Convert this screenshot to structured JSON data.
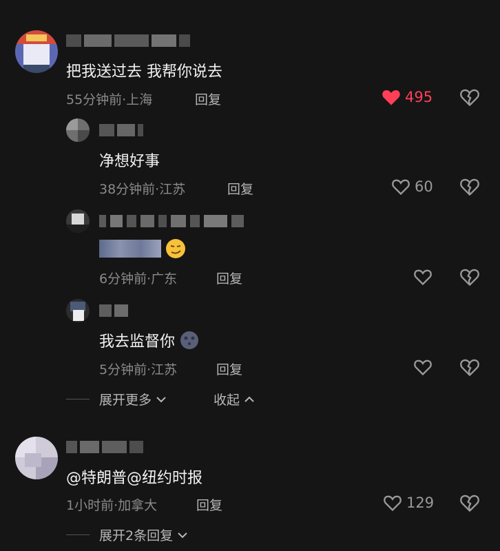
{
  "comments": [
    {
      "text": "把我送过去 我帮你说去",
      "time_location": "55分钟前·上海",
      "reply_label": "回复",
      "likes": "495",
      "liked": true,
      "colors": {
        "liked": "#ff3f57"
      }
    },
    {
      "text": "净想好事",
      "time_location": "38分钟前·江苏",
      "reply_label": "回复",
      "likes": "60"
    },
    {
      "text": "",
      "time_location": "6分钟前·广东",
      "reply_label": "回复",
      "likes": ""
    },
    {
      "text": "我去监督你",
      "time_location": "5分钟前·江苏",
      "reply_label": "回复",
      "likes": ""
    },
    {
      "text": "@特朗普@纽约时报",
      "time_location": "1小时前·加拿大",
      "reply_label": "回复",
      "likes": "129"
    }
  ],
  "thread1": {
    "expand_more": "展开更多",
    "collapse": "收起"
  },
  "thread2": {
    "expand_replies": "展开2条回复"
  }
}
